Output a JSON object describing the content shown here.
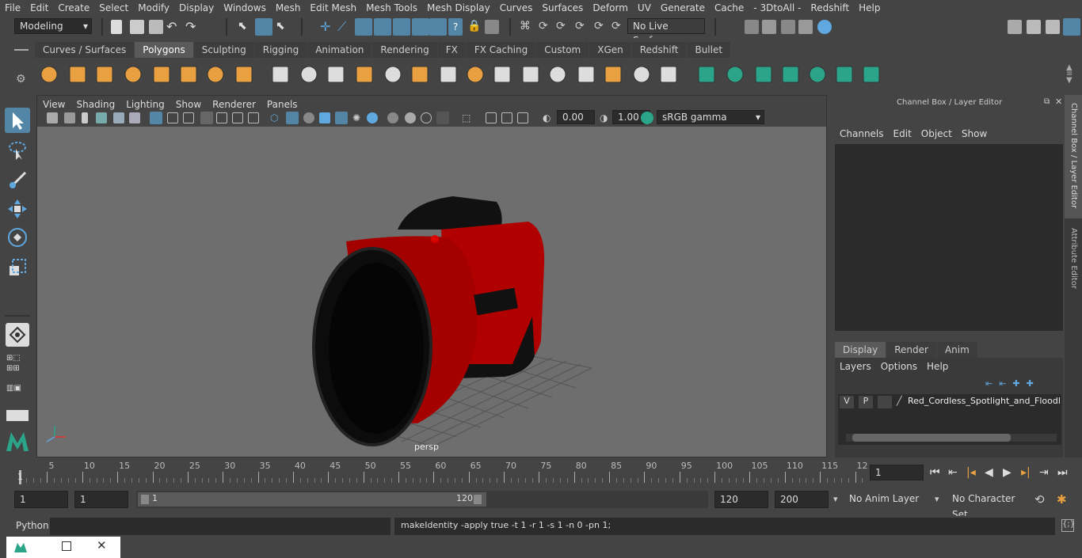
{
  "menubar": {
    "items": [
      "File",
      "Edit",
      "Create",
      "Select",
      "Modify",
      "Display",
      "Windows",
      "Mesh",
      "Edit Mesh",
      "Mesh Tools",
      "Mesh Display",
      "Curves",
      "Surfaces",
      "Deform",
      "UV",
      "Generate",
      "Cache",
      "- 3DtoAll -",
      "Redshift",
      "Help"
    ]
  },
  "status": {
    "mode": "Modeling",
    "live_surface": "No Live Surface"
  },
  "shelf": {
    "tabs": [
      "Curves / Surfaces",
      "Polygons",
      "Sculpting",
      "Rigging",
      "Animation",
      "Rendering",
      "FX",
      "FX Caching",
      "Custom",
      "XGen",
      "Redshift",
      "Bullet"
    ],
    "active": "Polygons"
  },
  "viewport": {
    "menu": [
      "View",
      "Shading",
      "Lighting",
      "Show",
      "Renderer",
      "Panels"
    ],
    "exposure": "0.00",
    "gamma": "1.00",
    "colorspace": "sRGB gamma",
    "camera": "persp"
  },
  "channelbox": {
    "title": "Channel Box / Layer Editor",
    "menu": [
      "Channels",
      "Edit",
      "Object",
      "Show"
    ],
    "tabs": [
      "Display",
      "Render",
      "Anim"
    ],
    "active_tab": "Display",
    "layer_menu": [
      "Layers",
      "Options",
      "Help"
    ],
    "layer": {
      "v": "V",
      "p": "P",
      "name": "Red_Cordless_Spotlight_and_Floodlig"
    }
  },
  "sidetabs": {
    "channel": "Channel Box / Layer Editor",
    "attr": "Attribute Editor"
  },
  "timeline": {
    "ticks": [
      "5",
      "10",
      "15",
      "20",
      "25",
      "30",
      "35",
      "40",
      "45",
      "50",
      "55",
      "60",
      "65",
      "70",
      "75",
      "80",
      "85",
      "90",
      "95",
      "100",
      "105",
      "110",
      "115",
      "12"
    ],
    "start_label": "1",
    "current_frame": "1"
  },
  "range": {
    "start": "1",
    "playstart": "1",
    "slider_start": "1",
    "slider_end": "120",
    "playend": "120",
    "end": "200",
    "anim_layer": "No Anim Layer",
    "char_set": "No Character Set"
  },
  "cmd": {
    "lang": "Python",
    "result": "makeIdentity -apply true -t 1 -r 1 -s 1 -n 0 -pn 1;"
  },
  "colors": {
    "accent": "#5285a6",
    "red": "#c00000",
    "shelf_green": "#2aa58a",
    "shelf_orange": "#e8a040"
  }
}
